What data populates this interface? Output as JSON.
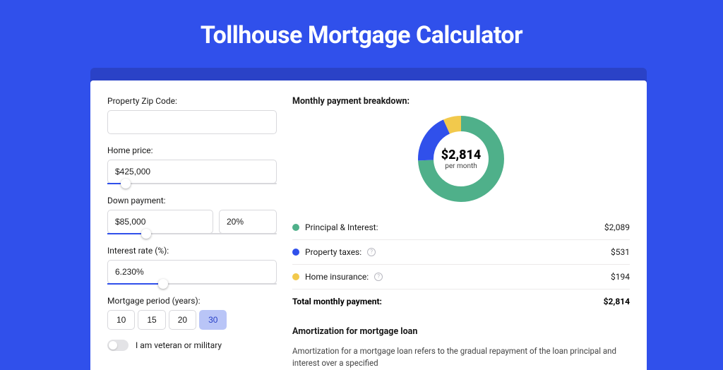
{
  "title": "Tollhouse Mortgage Calculator",
  "form": {
    "zip_label": "Property Zip Code:",
    "zip_value": "",
    "home_price_label": "Home price:",
    "home_price_value": "$425,000",
    "home_price_slider_pct": 8,
    "down_payment_label": "Down payment:",
    "down_payment_value": "$85,000",
    "down_payment_pct_value": "20%",
    "down_payment_slider_pct": 20,
    "interest_label": "Interest rate (%):",
    "interest_value": "6.230%",
    "interest_slider_pct": 30,
    "period_label": "Mortgage period (years):",
    "periods": [
      "10",
      "15",
      "20",
      "30"
    ],
    "period_active": "30",
    "veteran_label": "I am veteran or military"
  },
  "breakdown": {
    "title": "Monthly payment breakdown:",
    "total_amount": "$2,814",
    "total_sub": "per month",
    "items": [
      {
        "label": "Principal & Interest:",
        "value": "$2,089",
        "color": "#4fb08a",
        "info": false
      },
      {
        "label": "Property taxes:",
        "value": "$531",
        "color": "#3050eb",
        "info": true
      },
      {
        "label": "Home insurance:",
        "value": "$194",
        "color": "#f2c94c",
        "info": true
      }
    ],
    "total_label": "Total monthly payment:",
    "total_value": "$2,814"
  },
  "chart_data": {
    "type": "pie",
    "title": "Monthly payment breakdown",
    "series": [
      {
        "name": "Principal & Interest",
        "value": 2089,
        "color": "#4fb08a"
      },
      {
        "name": "Property taxes",
        "value": 531,
        "color": "#3050eb"
      },
      {
        "name": "Home insurance",
        "value": 194,
        "color": "#f2c94c"
      }
    ],
    "total": 2814,
    "center_label": "$2,814",
    "center_sublabel": "per month"
  },
  "amortization": {
    "title": "Amortization for mortgage loan",
    "body": "Amortization for a mortgage loan refers to the gradual repayment of the loan principal and interest over a specified"
  }
}
